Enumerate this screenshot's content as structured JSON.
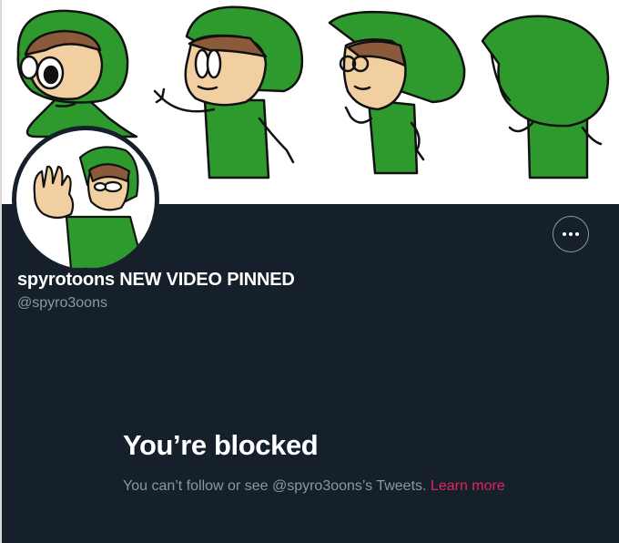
{
  "profile": {
    "display_name": "spyrotoons NEW VIDEO PINNED",
    "handle": "@spyro3oons",
    "banner_image": "banner-green-hood-character-drawings",
    "avatar_image": "avatar-green-hood-character-waving"
  },
  "actions": {
    "more_icon": "more-horizontal-icon"
  },
  "blocked": {
    "title": "You’re blocked",
    "message": "You can’t follow or see @spyro3oons’s Tweets. ",
    "learn_more": "Learn more"
  },
  "colors": {
    "background": "#15202b",
    "primary_text": "#ffffff",
    "secondary_text": "#8899a6",
    "link": "#e0245e",
    "character_green": "#2e9a2e",
    "skin": "#f2cfa0",
    "hair": "#8a5a3a"
  }
}
